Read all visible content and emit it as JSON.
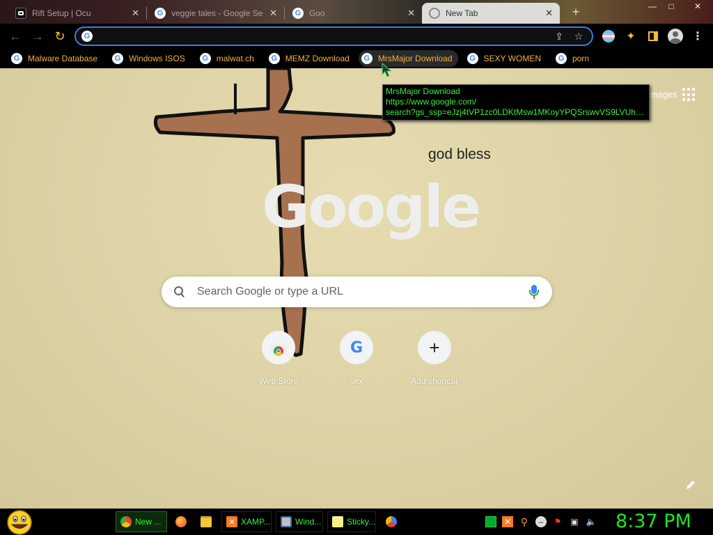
{
  "browser": {
    "tabs": [
      {
        "title": "Rift Setup | Ocu",
        "icon": "oculus-icon"
      },
      {
        "title": "veggie tales - Google Se",
        "icon": "google-icon"
      },
      {
        "title": "Goo",
        "icon": "google-icon"
      },
      {
        "title": "New Tab",
        "icon": "chrome-icon",
        "active": true
      }
    ],
    "window_controls": {
      "minimize": "—",
      "maximize": "□",
      "close": "✕"
    },
    "omnibox": {
      "value": "",
      "placeholder": ""
    },
    "bookmarks": [
      {
        "label": "Malware Database"
      },
      {
        "label": "Windows ISOS"
      },
      {
        "label": "malwat.ch"
      },
      {
        "label": "MEMZ Download"
      },
      {
        "label": "MrsMajor Download",
        "hovered": true
      },
      {
        "label": "SEXY WOMEN"
      },
      {
        "label": "porn"
      }
    ],
    "tooltip": {
      "title": "MrsMajor Download",
      "url_line1": "https://www.google.com/",
      "url_line2": "search?gs_ssp=eJzj4tVP1zc0LDKtMsw1MKoyYPQSrswvVS9LVUhKTc1T..."
    }
  },
  "newtab": {
    "images_link": "Images",
    "background_text": "god bless",
    "logo_text": "Google",
    "search_placeholder": "Search Google or type a URL",
    "shortcuts": [
      {
        "label": "Web Store",
        "icon": "webstore-icon"
      },
      {
        "label": "sex",
        "icon": "google-icon"
      },
      {
        "label": "Add shortcut",
        "icon": "plus-icon"
      }
    ]
  },
  "taskbar": {
    "tasks": [
      {
        "label": "New ...",
        "icon": "chrome-icon",
        "active": true
      },
      {
        "label": "",
        "icon": "firefox-icon"
      },
      {
        "label": "",
        "icon": "folder-icon"
      },
      {
        "label": "XAMP...",
        "icon": "xampp-icon"
      },
      {
        "label": "Wind...",
        "icon": "window-icon"
      },
      {
        "label": "Sticky...",
        "icon": "sticky-notes-icon"
      },
      {
        "label": "",
        "icon": "chromium-icon"
      }
    ],
    "clock": "8:37 PM"
  },
  "colors": {
    "bookmark_text": "#f3b340",
    "tooltip_text": "#3cf03c",
    "clock": "#1fe61f",
    "omnibox_focus": "#3b7de8"
  }
}
